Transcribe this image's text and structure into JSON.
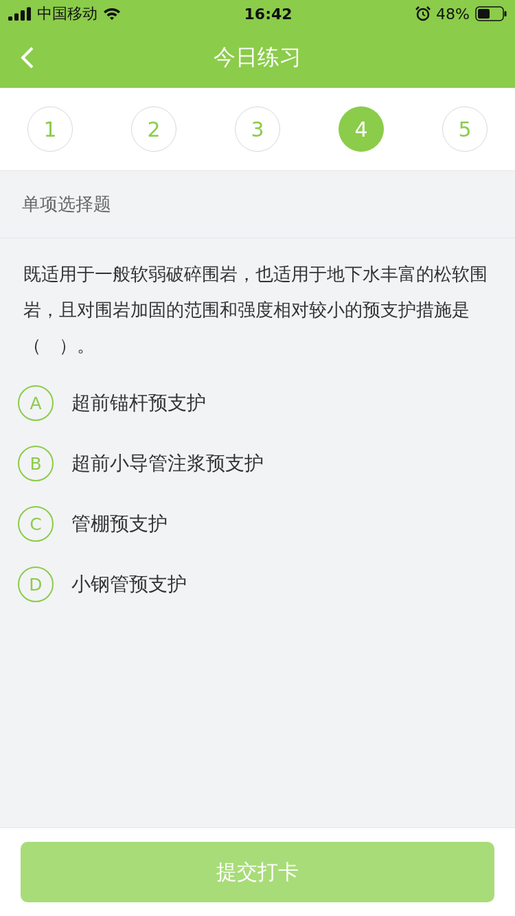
{
  "status_bar": {
    "carrier": "中国移动",
    "time": "16:42",
    "battery": "48%"
  },
  "header": {
    "title": "今日练习"
  },
  "steps": [
    {
      "label": "1",
      "selected": false
    },
    {
      "label": "2",
      "selected": false
    },
    {
      "label": "3",
      "selected": false
    },
    {
      "label": "4",
      "selected": true
    },
    {
      "label": "5",
      "selected": false
    }
  ],
  "question": {
    "type": "单项选择题",
    "text": "既适用于一般软弱破碎围岩，也适用于地下水丰富的松软围岩，且对围岩加固的范围和强度相对较小的预支护措施是（　）。",
    "options": [
      {
        "letter": "A",
        "text": "超前锚杆预支护",
        "selected": false
      },
      {
        "letter": "B",
        "text": "超前小导管注浆预支护",
        "selected": false
      },
      {
        "letter": "C",
        "text": "管棚预支护",
        "selected": false
      },
      {
        "letter": "D",
        "text": "小钢管预支护",
        "selected": false
      }
    ]
  },
  "submit": {
    "label": "提交打卡",
    "disabled": true
  }
}
